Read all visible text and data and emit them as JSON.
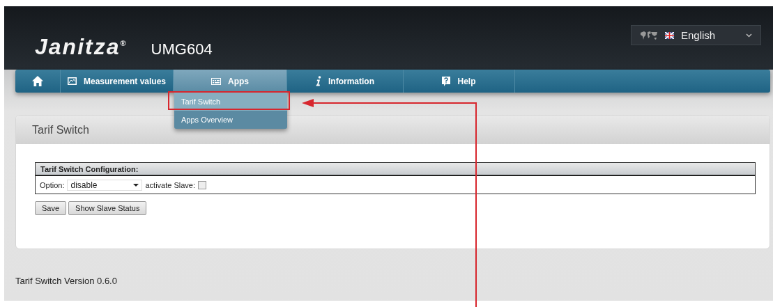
{
  "header": {
    "logo": "Janitza",
    "logo_mark": "®",
    "device": "UMG604",
    "language": {
      "value": "English"
    }
  },
  "nav": [
    {
      "kind": "home",
      "selected": false
    },
    {
      "kind": "chart",
      "label": "Measurement values",
      "selected": false
    },
    {
      "kind": "apps",
      "label": "Apps",
      "selected": true
    },
    {
      "kind": "info",
      "label": "Information",
      "selected": false
    },
    {
      "kind": "help",
      "label": "Help",
      "selected": false
    }
  ],
  "menu": [
    {
      "label": "Tarif Switch",
      "selected": true
    },
    {
      "label": "Apps Overview",
      "selected": false
    }
  ],
  "panel": {
    "title": "Tarif Switch",
    "config_title": "Tarif Switch Configuration:",
    "option_label": "Option:",
    "option_value": "disable",
    "slave_label": "activate Slave:",
    "slave_checked": false,
    "buttons": [
      "Save",
      "Show Slave Status"
    ]
  },
  "footer": "Tarif Switch Version 0.6.0"
}
